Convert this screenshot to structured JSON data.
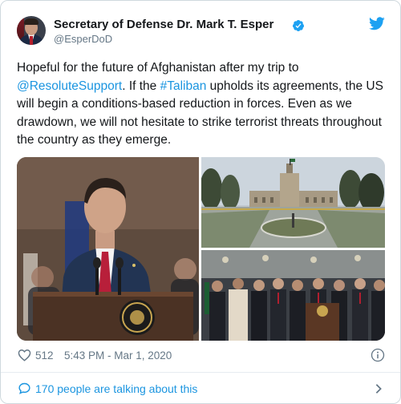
{
  "tweet": {
    "author_name": "Secretary of Defense Dr. Mark T. Esper",
    "author_handle": "@EsperDoD",
    "text_part1": "Hopeful for the future of Afghanistan after my trip to ",
    "mention": "@ResoluteSupport",
    "text_part2": ". If the ",
    "hashtag": "#Taliban",
    "text_part3": " upholds its agreements, the US will begin a conditions-based reduction in forces. Even as we drawdown, we will not hesitate to strike terrorist threats throughout the country as they emerge.",
    "like_count": "512",
    "timestamp": "5:43 PM - Mar 1, 2020",
    "conversation_text": "170 people are talking about this"
  },
  "colors": {
    "link": "#1b95e0",
    "secondary_text": "#657786",
    "divider": "#e6ecf0"
  },
  "icons": {
    "verified": "verified-badge-icon",
    "brand": "twitter-bird-icon",
    "like": "heart-icon",
    "info": "info-icon",
    "conversation": "speech-bubble-icon",
    "navigate": "chevron-right-icon"
  }
}
